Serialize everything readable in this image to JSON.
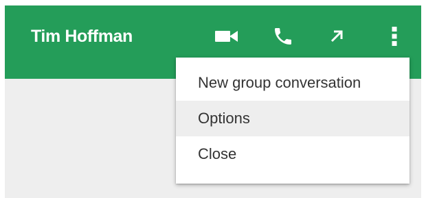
{
  "header": {
    "contact_name": "Tim Hoffman",
    "background_color": "#249d59",
    "icons": [
      "video-call-icon",
      "phone-call-icon",
      "pop-out-icon",
      "more-vert-icon"
    ]
  },
  "menu": {
    "items": [
      {
        "label": "New group conversation",
        "highlighted": false
      },
      {
        "label": "Options",
        "highlighted": true
      },
      {
        "label": "Close",
        "highlighted": false
      }
    ]
  }
}
